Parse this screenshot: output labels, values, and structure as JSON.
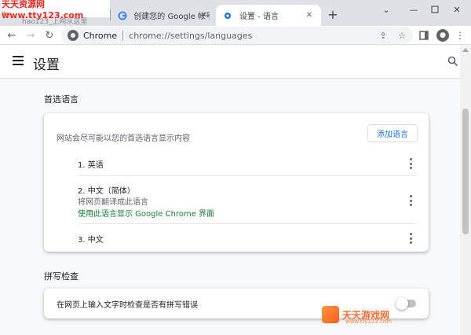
{
  "watermark": {
    "site": "天天资源网 www.tty123.com",
    "tag": "Hao"
  },
  "tabs": [
    {
      "title": "hao123_上网从这里",
      "icon": "hao123-icon"
    },
    {
      "title": "创建您的 Google 帐号",
      "icon": "google-g-icon"
    },
    {
      "title": "设置 - 语言",
      "icon": "gear-icon",
      "active": true
    }
  ],
  "toolbar": {
    "omnibox_label": "Chrome",
    "omnibox_url": "chrome://settings/languages"
  },
  "settings": {
    "title": "设置",
    "preferred_languages": {
      "section_title": "首选语言",
      "description": "网站会尽可能以您的首选语言显示内容",
      "add_button": "添加语言",
      "languages": [
        {
          "name": "1. 英语"
        },
        {
          "name": "2. 中文（简体）",
          "sub1": "将网页翻译成此语言",
          "sub2": "使用此语言显示 Google Chrome 界面"
        },
        {
          "name": "3. 中文"
        }
      ]
    },
    "spellcheck": {
      "section_title": "拼写检查",
      "label": "在网页上输入文字时检查是否有拼写错误",
      "enabled": false
    }
  },
  "bottom_watermark": {
    "text": "天天游戏网",
    "url": "www.tty123.com"
  },
  "colors": {
    "accent": "#1a73e8",
    "green_text": "#188038",
    "watermark_red": "#e8271e"
  }
}
